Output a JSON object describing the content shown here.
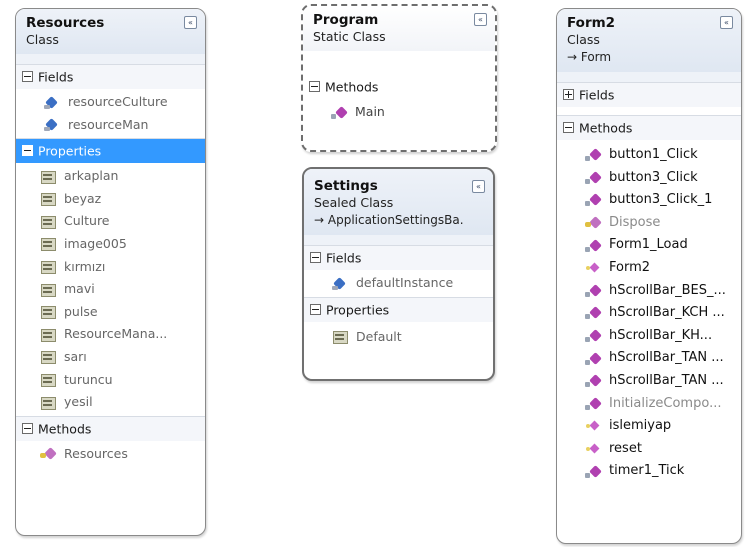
{
  "collapse_glyph": "«",
  "resources": {
    "name": "Resources",
    "kind": "Class",
    "sections": {
      "fields": "Fields",
      "properties": "Properties",
      "methods": "Methods"
    },
    "fields": [
      "resourceCulture",
      "resourceMan"
    ],
    "properties": [
      "arkaplan",
      "beyaz",
      "Culture",
      "image005",
      "kırmızı",
      "mavi",
      "pulse",
      "ResourceMana...",
      "sarı",
      "turuncu",
      "yesil"
    ],
    "methods": [
      "Resources"
    ]
  },
  "program": {
    "name": "Program",
    "kind": "Static Class",
    "sections": {
      "methods": "Methods"
    },
    "methods": [
      "Main"
    ]
  },
  "settings": {
    "name": "Settings",
    "kind": "Sealed Class",
    "base": "→ ApplicationSettingsBa...",
    "sections": {
      "fields": "Fields",
      "properties": "Properties"
    },
    "fields": [
      "defaultInstance"
    ],
    "properties": [
      "Default"
    ]
  },
  "form2": {
    "name": "Form2",
    "kind": "Class",
    "base": "→ Form",
    "sections": {
      "fields": "Fields",
      "methods": "Methods"
    },
    "methods": [
      "button1_Click",
      "button3_Click",
      "button3_Click_1",
      "Dispose",
      "Form1_Load",
      "Form2",
      "hScrollBar_BES_...",
      "hScrollBar_KCH ...",
      "hScrollBar_KH...",
      "hScrollBar_TAN ...",
      "hScrollBar_TAN ...",
      "InitializeCompo...",
      "islemiyap",
      "reset",
      "timer1_Tick"
    ]
  }
}
